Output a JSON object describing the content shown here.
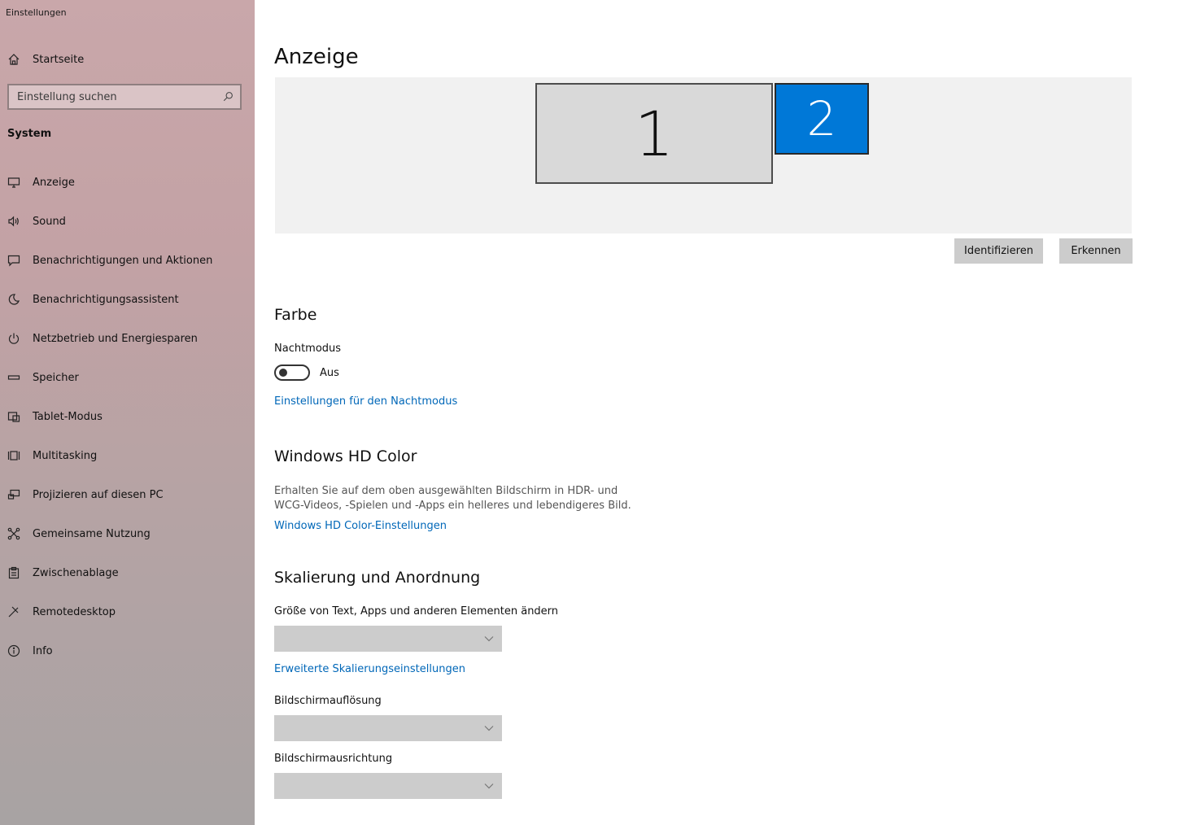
{
  "app": {
    "title": "Einstellungen"
  },
  "sidebar": {
    "home_label": "Startseite",
    "search_placeholder": "Einstellung suchen",
    "section": "System",
    "items": [
      {
        "label": "Anzeige",
        "icon": "monitor-icon"
      },
      {
        "label": "Sound",
        "icon": "speaker-icon"
      },
      {
        "label": "Benachrichtigungen und Aktionen",
        "icon": "message-icon"
      },
      {
        "label": "Benachrichtigungsassistent",
        "icon": "moon-icon"
      },
      {
        "label": "Netzbetrieb und Energiesparen",
        "icon": "power-icon"
      },
      {
        "label": "Speicher",
        "icon": "storage-icon"
      },
      {
        "label": "Tablet-Modus",
        "icon": "tablet-icon"
      },
      {
        "label": "Multitasking",
        "icon": "multitasking-icon"
      },
      {
        "label": "Projizieren auf diesen PC",
        "icon": "project-icon"
      },
      {
        "label": "Gemeinsame Nutzung",
        "icon": "share-icon"
      },
      {
        "label": "Zwischenablage",
        "icon": "clipboard-icon"
      },
      {
        "label": "Remotedesktop",
        "icon": "remote-icon"
      },
      {
        "label": "Info",
        "icon": "info-icon"
      }
    ]
  },
  "main": {
    "title": "Anzeige",
    "monitors": [
      {
        "number": "1",
        "selected": false
      },
      {
        "number": "2",
        "selected": true
      }
    ],
    "identify_label": "Identifizieren",
    "detect_label": "Erkennen",
    "color": {
      "heading": "Farbe",
      "night_mode_label": "Nachtmodus",
      "night_mode_state": "Aus",
      "night_mode_link": "Einstellungen für den Nachtmodus"
    },
    "hdr": {
      "heading": "Windows HD Color",
      "description": "Erhalten Sie auf dem oben ausgewählten Bildschirm in HDR- und WCG-Videos, -Spielen und -Apps ein helleres und lebendigeres Bild.",
      "link": "Windows HD Color-Einstellungen"
    },
    "scale": {
      "heading": "Skalierung und Anordnung",
      "size_label": "Größe von Text, Apps und anderen Elementen ändern",
      "advanced_link": "Erweiterte Skalierungseinstellungen",
      "resolution_label": "Bildschirmauflösung",
      "orientation_label": "Bildschirmausrichtung"
    }
  },
  "colors": {
    "accent": "#0078d7",
    "link": "#0067b8",
    "button": "#cccccc"
  }
}
